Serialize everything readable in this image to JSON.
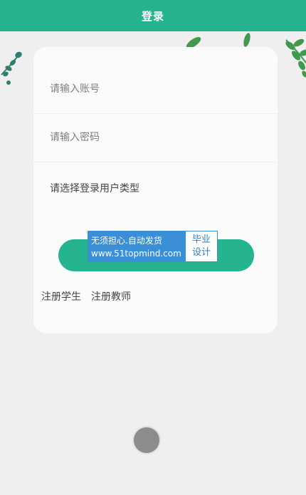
{
  "header": {
    "title": "登录"
  },
  "form": {
    "account_placeholder": "请输入账号",
    "password_placeholder": "请输入密码",
    "user_type_select": "请选择登录用户类型",
    "login_label": ""
  },
  "links": {
    "register_student": "注册学生",
    "register_teacher": "注册教师"
  },
  "watermark": {
    "line1": "无须担心.自动发货",
    "line2": "www.51topmind.com",
    "right_top": "毕业",
    "right_bottom": "设计"
  },
  "colors": {
    "primary": "#26b48f",
    "background": "#efefef",
    "card": "#fbfbfb",
    "watermark_blue": "#3b8fd6"
  }
}
